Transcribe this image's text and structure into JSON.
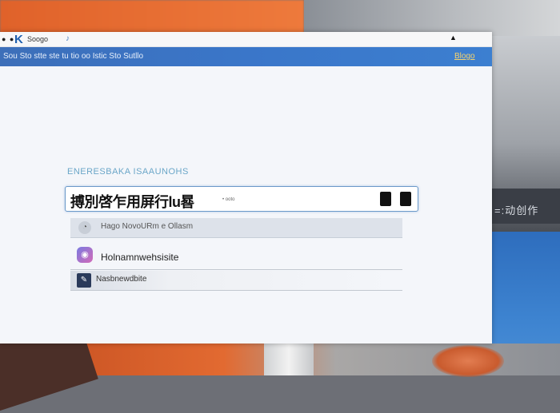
{
  "window": {
    "title": "Soogo",
    "menu_text": "Sou Sto stte ste tu tio oo Istic Sto Sutllo",
    "menu_right": "Blogo"
  },
  "search": {
    "caption": "ENERESBAKA ISAAUNOHS",
    "value": "搏別啓乍用屏行lu晷",
    "sub": "• ooto"
  },
  "suggestions": [
    {
      "icon": "clock-icon",
      "text": "Hago NovoURm e Ollasm"
    },
    {
      "icon": "app-icon",
      "text": "Holnamnwehsisite"
    },
    {
      "icon": "site-icon",
      "text": "Nasbnewdbite"
    }
  ],
  "background_label": "=:动创作"
}
